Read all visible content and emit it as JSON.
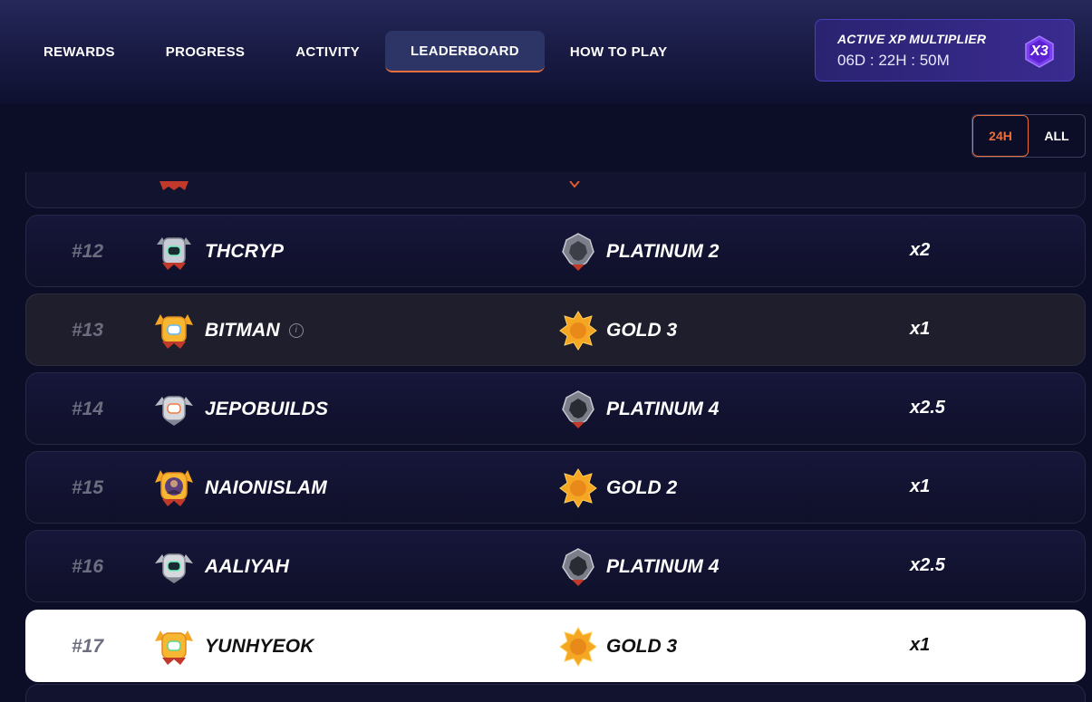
{
  "nav": {
    "tabs": [
      {
        "label": "REWARDS"
      },
      {
        "label": "PROGRESS"
      },
      {
        "label": "ACTIVITY"
      },
      {
        "label": "LEADERBOARD"
      },
      {
        "label": "HOW TO PLAY"
      }
    ],
    "active_tab": "LEADERBOARD"
  },
  "xp_multiplier": {
    "title": "ACTIVE XP MULTIPLIER",
    "timer": "06D : 22H : 50M",
    "badge": "X3"
  },
  "filter": {
    "options": [
      "24H",
      "ALL"
    ],
    "selected": "24H"
  },
  "leaderboard": {
    "rows": [
      {
        "rank": "#12",
        "player": "THCRYP",
        "tier": "PLATINUM 2",
        "multiplier": "x2",
        "tier_type": "platinum"
      },
      {
        "rank": "#13",
        "player": "BITMAN",
        "tier": "GOLD 3",
        "multiplier": "x1",
        "tier_type": "gold",
        "has_info": true
      },
      {
        "rank": "#14",
        "player": "JEPOBUILDS",
        "tier": "PLATINUM 4",
        "multiplier": "x2.5",
        "tier_type": "platinum"
      },
      {
        "rank": "#15",
        "player": "NAIONISLAM",
        "tier": "GOLD 2",
        "multiplier": "x1",
        "tier_type": "gold"
      },
      {
        "rank": "#16",
        "player": "AALIYAH",
        "tier": "PLATINUM 4",
        "multiplier": "x2.5",
        "tier_type": "platinum"
      },
      {
        "rank": "#17",
        "player": "YUNHYEOK",
        "tier": "GOLD 3",
        "multiplier": "x1",
        "tier_type": "gold",
        "is_current_user": true
      }
    ]
  },
  "colors": {
    "accent": "#ea6f3d",
    "background": "#0c0d26",
    "xp_purple": "#3a2b90",
    "platinum": "#9a9aa6",
    "gold": "#f5a623"
  }
}
